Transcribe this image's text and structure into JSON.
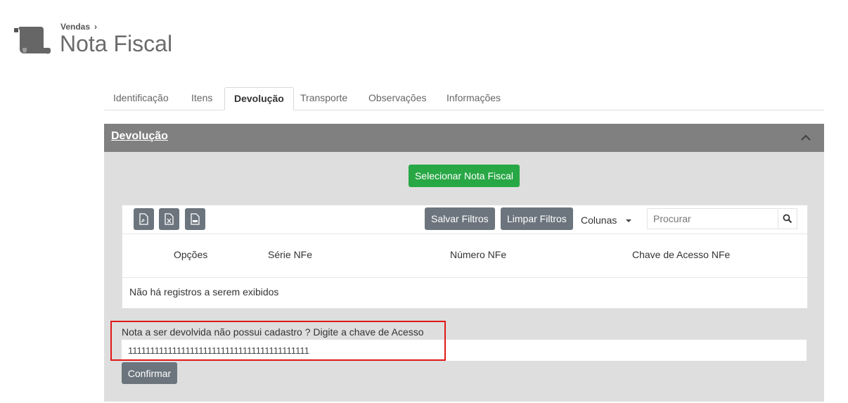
{
  "breadcrumb": {
    "parent": "Vendas",
    "separator": "›"
  },
  "page": {
    "title": "Nota Fiscal",
    "icon": "scroll-icon"
  },
  "tabs": [
    {
      "label": "Identificação",
      "active": false
    },
    {
      "label": "Itens",
      "active": false
    },
    {
      "label": "Devolução",
      "active": true
    },
    {
      "label": "Transporte",
      "active": false
    },
    {
      "label": "Observações",
      "active": false
    },
    {
      "label": "Informações",
      "active": false
    }
  ],
  "panel": {
    "title": "Devolução",
    "collapse_icon": "chevron-up-icon",
    "select_button": "Selecionar Nota Fiscal"
  },
  "table": {
    "export_icons": [
      "pdf-file-icon",
      "excel-file-icon",
      "csv-file-icon"
    ],
    "save_filters": "Salvar Filtros",
    "clear_filters": "Limpar Filtros",
    "columns_label": "Colunas",
    "search_placeholder": "Procurar",
    "headers": [
      "Opções",
      "Série NFe",
      "Número NFe",
      "Chave de Acesso NFe"
    ],
    "empty_message": "Não há registros a serem exibidos"
  },
  "access_key": {
    "label": "Nota a ser devolvida não possui cadastro ? Digite a chave de Acesso",
    "value": "11111111111111111111111111111111111111111",
    "confirm_button": "Confirmar"
  },
  "colors": {
    "accent_green": "#28a745",
    "button_gray": "#6c757d",
    "panel_header": "#808080",
    "panel_body": "#dedede",
    "highlight": "#e01818"
  }
}
